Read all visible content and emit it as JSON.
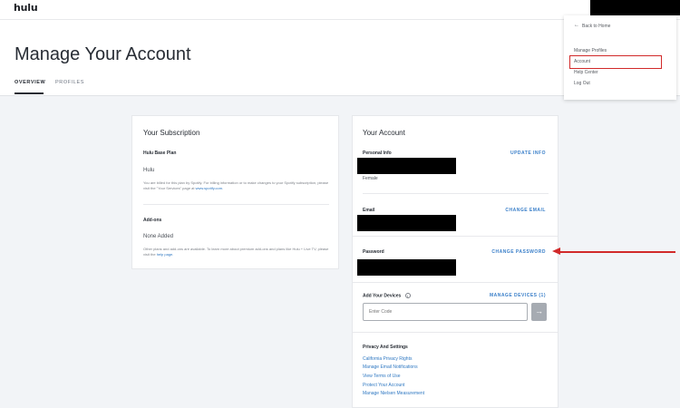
{
  "app": {
    "logo": "hulu"
  },
  "header": {
    "title": "Manage Your Account",
    "tabs": [
      {
        "label": "OVERVIEW",
        "active": true
      },
      {
        "label": "PROFILES",
        "active": false
      }
    ]
  },
  "subscription": {
    "title": "Your Subscription",
    "base_plan_label": "Hulu Base Plan",
    "plan_name": "Hulu",
    "billing_text": "You are billed for this plan by Spotify. For billing information or to make changes to your Spotify subscription, please visit the \"Your Services\" page at",
    "billing_link": "www.spotify.com.",
    "addons_label": "Add-ons",
    "addons_value": "None Added",
    "addons_text": "Other plans and add-ons are available. To learn more about premium add-ons and plans like Hulu + Live TV, please visit the",
    "addons_link": "help page."
  },
  "account": {
    "title": "Your Account",
    "personal_info_label": "Personal Info",
    "update_info": "UPDATE INFO",
    "gender": "Female",
    "email_label": "Email",
    "change_email": "CHANGE EMAIL",
    "password_label": "Password",
    "change_password": "CHANGE PASSWORD",
    "devices_label": "Add Your Devices",
    "manage_devices": "MANAGE DEVICES (1)",
    "code_placeholder": "Enter Code",
    "privacy_label": "Privacy And Settings",
    "privacy_links": [
      "California Privacy Rights",
      "Manage Email Notifications",
      "View Terms of Use",
      "Protect Your Account",
      "Manage Nielsen Measurement"
    ]
  },
  "dropdown": {
    "back": "Back to Home",
    "items": [
      "Manage Profiles",
      "Account",
      "Help Center",
      "Log Out"
    ]
  },
  "colors": {
    "accent": "#3a7fc9",
    "highlight": "#d12a2a"
  },
  "icons": {
    "back": "arrow-left-icon",
    "submit": "arrow-right-icon",
    "info": "info-icon"
  }
}
